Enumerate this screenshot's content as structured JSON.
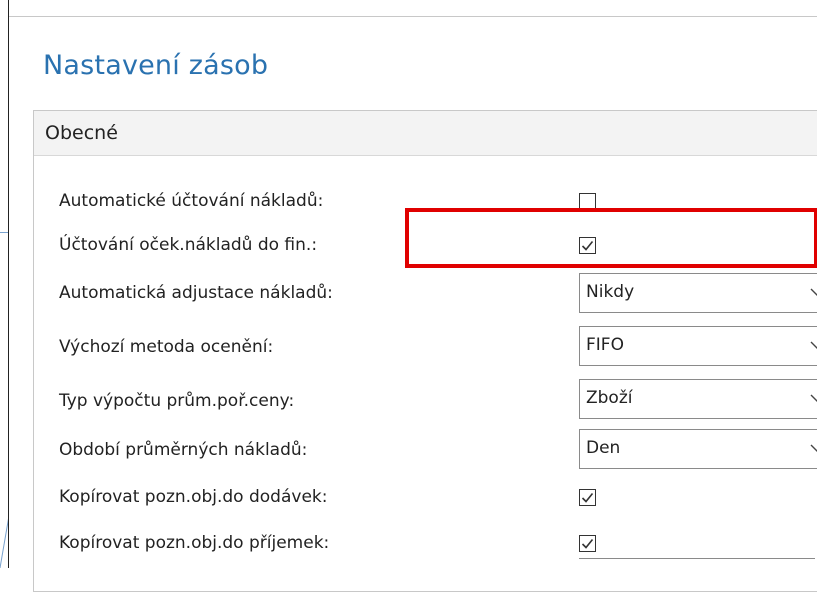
{
  "page": {
    "title": "Nastavení zásob"
  },
  "section": {
    "header": "Obecné"
  },
  "fields": [
    {
      "label": "Automatické účtování nákladů:",
      "type": "checkbox",
      "checked": false
    },
    {
      "label": "Účtování oček.nákladů do fin.:",
      "type": "checkbox",
      "checked": true
    },
    {
      "label": "Automatická adjustace nákladů:",
      "type": "select",
      "value": "Nikdy"
    },
    {
      "label": "Výchozí metoda ocenění:",
      "type": "select",
      "value": "FIFO"
    },
    {
      "label": "Typ výpočtu prům.poř.ceny:",
      "type": "select",
      "value": "Zboží"
    },
    {
      "label": "Období průměrných nákladů:",
      "type": "select",
      "value": "Den"
    },
    {
      "label": "Kopírovat pozn.obj.do dodávek:",
      "type": "checkbox",
      "checked": true
    },
    {
      "label": "Kopírovat pozn.obj.do příjemek:",
      "type": "checkbox",
      "checked": true
    }
  ],
  "colors": {
    "title": "#2a72b0",
    "highlight": "#e00000",
    "header_bg": "#f3f3f3"
  },
  "icons": {
    "checkmark": "check-icon",
    "dropdown": "chevron-down-icon"
  }
}
